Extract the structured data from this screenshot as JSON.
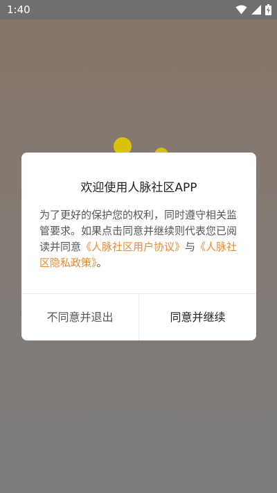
{
  "status_bar": {
    "time": "1:40",
    "icons": [
      "wifi-icon",
      "signal-icon",
      "battery-charging-icon"
    ]
  },
  "dialog": {
    "title": "欢迎使用人脉社区APP",
    "body_prefix": "为了更好的保护您的权利，同时遵守相关监管要求。如果点击同意并继续则代表您已阅读并同意",
    "user_agreement_link": "《人脉社区用户协议》",
    "connector": "与",
    "privacy_policy_link": "《人脉社区隐私政策》",
    "body_suffix": "。",
    "disagree_label": "不同意并退出",
    "agree_label": "同意并继续"
  },
  "colors": {
    "accent_link": "#f08a2c",
    "loader_dot": "#d8c20c"
  }
}
